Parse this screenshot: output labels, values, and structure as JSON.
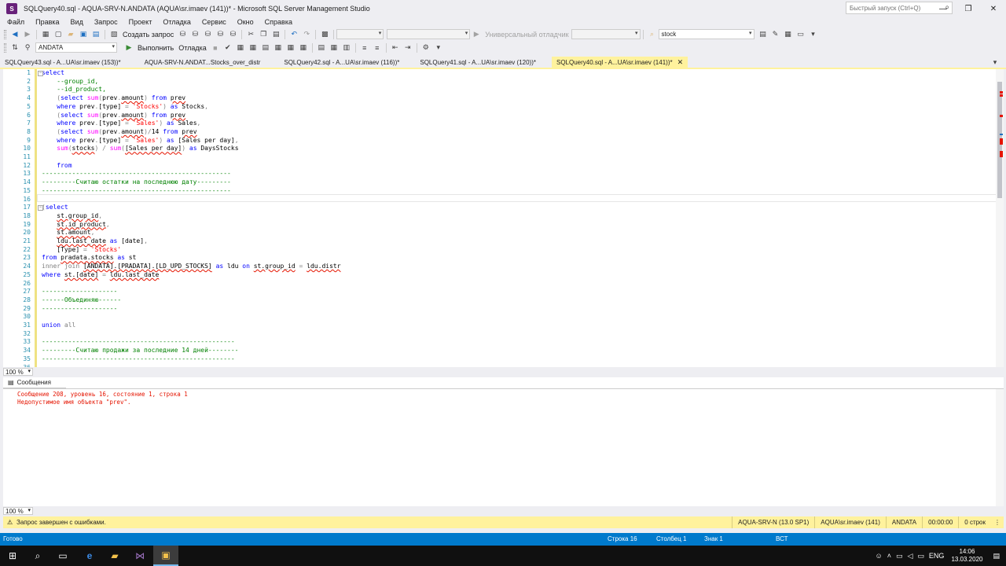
{
  "window": {
    "title": "SQLQuery40.sql - AQUA-SRV-N.ANDATA (AQUA\\sr.imaev (141))* - Microsoft SQL Server Management Studio",
    "quick_launch_placeholder": "Быстрый запуск (Ctrl+Q)"
  },
  "menu": [
    "Файл",
    "Правка",
    "Вид",
    "Запрос",
    "Проект",
    "Отладка",
    "Сервис",
    "Окно",
    "Справка"
  ],
  "toolbar1": {
    "new_query_label": "Создать запрос",
    "debugger_label": "Универсальный отладчик",
    "search_value": "stock"
  },
  "toolbar2": {
    "database": "ANDATA",
    "execute_label": "Выполнить",
    "debug_label": "Отладка"
  },
  "tabs": [
    {
      "label": "SQLQuery43.sql - A...UA\\sr.imaev (153))*",
      "active": false
    },
    {
      "label": "AQUA-SRV-N.ANDAT...Stocks_over_distr",
      "active": false
    },
    {
      "label": "SQLQuery42.sql - A...UA\\sr.imaev (116))*",
      "active": false
    },
    {
      "label": "SQLQuery41.sql - A...UA\\sr.imaev (120))*",
      "active": false
    },
    {
      "label": "SQLQuery40.sql - A...UA\\sr.imaev (141))*",
      "active": true
    }
  ],
  "editor": {
    "lines": [
      {
        "n": "1",
        "t": [
          [
            "kw",
            "select"
          ]
        ]
      },
      {
        "n": "2",
        "t": [
          [
            "cm",
            "    --group_id,"
          ]
        ]
      },
      {
        "n": "3",
        "t": [
          [
            "cm",
            "    --id_product,"
          ]
        ]
      },
      {
        "n": "4",
        "t": [
          [
            "gr",
            "    ("
          ],
          [
            "kw",
            "select "
          ],
          [
            "fn",
            "sum"
          ],
          [
            "gr",
            "("
          ],
          [
            "x",
            "prev"
          ],
          [
            "gr",
            "."
          ],
          [
            "sq",
            "amount"
          ],
          [
            "gr",
            ") "
          ],
          [
            "kw",
            "from "
          ],
          [
            "sq",
            "prev"
          ]
        ]
      },
      {
        "n": "5",
        "t": [
          [
            "kw",
            "    where "
          ],
          [
            "x",
            "prev"
          ],
          [
            "gr",
            "."
          ],
          [
            "x",
            "[type] "
          ],
          [
            "gr",
            "= "
          ],
          [
            "st",
            "'Stocks'"
          ],
          [
            "gr",
            ") "
          ],
          [
            "kw",
            "as "
          ],
          [
            "x",
            "Stocks"
          ],
          [
            "gr",
            ","
          ]
        ]
      },
      {
        "n": "6",
        "t": [
          [
            "gr",
            "    ("
          ],
          [
            "kw",
            "select "
          ],
          [
            "fn",
            "sum"
          ],
          [
            "gr",
            "("
          ],
          [
            "x",
            "prev"
          ],
          [
            "gr",
            "."
          ],
          [
            "sq",
            "amount"
          ],
          [
            "gr",
            ") "
          ],
          [
            "kw",
            "from "
          ],
          [
            "sq",
            "prev"
          ]
        ]
      },
      {
        "n": "7",
        "t": [
          [
            "kw",
            "    where "
          ],
          [
            "x",
            "prev"
          ],
          [
            "gr",
            "."
          ],
          [
            "x",
            "[type] "
          ],
          [
            "gr",
            "= "
          ],
          [
            "st",
            "'Sales'"
          ],
          [
            "gr",
            ") "
          ],
          [
            "kw",
            "as "
          ],
          [
            "x",
            "Sales"
          ],
          [
            "gr",
            ","
          ]
        ]
      },
      {
        "n": "8",
        "t": [
          [
            "gr",
            "    ("
          ],
          [
            "kw",
            "select "
          ],
          [
            "fn",
            "sum"
          ],
          [
            "gr",
            "("
          ],
          [
            "x",
            "prev"
          ],
          [
            "gr",
            "."
          ],
          [
            "sq",
            "amount"
          ],
          [
            "gr",
            ")/"
          ],
          [
            "x",
            "14 "
          ],
          [
            "kw",
            "from "
          ],
          [
            "sq",
            "prev"
          ]
        ]
      },
      {
        "n": "9",
        "t": [
          [
            "kw",
            "    where "
          ],
          [
            "x",
            "prev"
          ],
          [
            "gr",
            "."
          ],
          [
            "x",
            "[type] "
          ],
          [
            "gr",
            "= "
          ],
          [
            "st",
            "'Sales'"
          ],
          [
            "gr",
            ") "
          ],
          [
            "kw",
            "as "
          ],
          [
            "x",
            "[Sales per day]"
          ],
          [
            "gr",
            ","
          ]
        ]
      },
      {
        "n": "10",
        "t": [
          [
            "fn",
            "    sum"
          ],
          [
            "gr",
            "("
          ],
          [
            "sq",
            "stocks"
          ],
          [
            "gr",
            ") / "
          ],
          [
            "fn",
            "sum"
          ],
          [
            "gr",
            "("
          ],
          [
            "sq",
            "[Sales per day]"
          ],
          [
            "gr",
            ") "
          ],
          [
            "kw",
            "as "
          ],
          [
            "x",
            "DaysStocks"
          ]
        ]
      },
      {
        "n": "11",
        "t": []
      },
      {
        "n": "12",
        "t": [
          [
            "kw",
            "    from"
          ]
        ]
      },
      {
        "n": "13",
        "t": [
          [
            "cm",
            "--------------------------------------------------"
          ]
        ]
      },
      {
        "n": "14",
        "t": [
          [
            "cm",
            "---------Считаю остатки на последнюю дату---------"
          ]
        ]
      },
      {
        "n": "15",
        "t": [
          [
            "cm",
            "--------------------------------------------------"
          ]
        ]
      },
      {
        "n": "16",
        "t": []
      },
      {
        "n": "17",
        "t": [
          [
            "gr",
            "("
          ],
          [
            "kw",
            "select"
          ]
        ]
      },
      {
        "n": "18",
        "t": [
          [
            "x",
            "    "
          ],
          [
            "sq",
            "st.group_id"
          ],
          [
            "gr",
            ","
          ]
        ]
      },
      {
        "n": "19",
        "t": [
          [
            "x",
            "    "
          ],
          [
            "sq",
            "st.id_product"
          ],
          [
            "gr",
            ","
          ]
        ]
      },
      {
        "n": "20",
        "t": [
          [
            "x",
            "    "
          ],
          [
            "sq",
            "st.amount"
          ],
          [
            "gr",
            ","
          ]
        ]
      },
      {
        "n": "21",
        "t": [
          [
            "x",
            "    "
          ],
          [
            "sq",
            "ldu.last_date"
          ],
          [
            "kw",
            " as "
          ],
          [
            "x",
            "[date]"
          ],
          [
            "gr",
            ","
          ]
        ]
      },
      {
        "n": "22",
        "t": [
          [
            "x",
            "    [Type] "
          ],
          [
            "gr",
            "= "
          ],
          [
            "st",
            "'Stocks'"
          ]
        ]
      },
      {
        "n": "23",
        "t": [
          [
            "kw",
            "from "
          ],
          [
            "sq",
            "pradata.stocks"
          ],
          [
            "kw",
            " as "
          ],
          [
            "x",
            "st"
          ]
        ]
      },
      {
        "n": "24",
        "t": [
          [
            "gr",
            "inner join "
          ],
          [
            "sq",
            "[ANDATA].[PRADATA].[LD_UPD_STOCKS]"
          ],
          [
            "kw",
            " as "
          ],
          [
            "x",
            "ldu "
          ],
          [
            "kw",
            "on "
          ],
          [
            "sq",
            "st.group_id"
          ],
          [
            "gr",
            " = "
          ],
          [
            "sq",
            "ldu.distr"
          ]
        ]
      },
      {
        "n": "25",
        "t": [
          [
            "kw",
            "where "
          ],
          [
            "sq",
            "st.[date]"
          ],
          [
            "gr",
            " = "
          ],
          [
            "sq",
            "ldu.last_date"
          ]
        ]
      },
      {
        "n": "26",
        "t": []
      },
      {
        "n": "27",
        "t": [
          [
            "cm",
            "--------------------"
          ]
        ]
      },
      {
        "n": "28",
        "t": [
          [
            "cm",
            "------Объединяю------"
          ]
        ]
      },
      {
        "n": "29",
        "t": [
          [
            "cm",
            "--------------------"
          ]
        ]
      },
      {
        "n": "30",
        "t": []
      },
      {
        "n": "31",
        "t": [
          [
            "kw",
            "union "
          ],
          [
            "gr",
            "all"
          ]
        ]
      },
      {
        "n": "32",
        "t": []
      },
      {
        "n": "33",
        "t": [
          [
            "cm",
            "---------------------------------------------------"
          ]
        ]
      },
      {
        "n": "34",
        "t": [
          [
            "cm",
            "---------Считаю продажи за последние 14 дней--------"
          ]
        ]
      },
      {
        "n": "35",
        "t": [
          [
            "cm",
            "---------------------------------------------------"
          ]
        ]
      },
      {
        "n": "36",
        "t": []
      }
    ],
    "zoom": "100 %"
  },
  "results": {
    "tab_label": "Сообщения",
    "messages": [
      "Сообщение 208, уровень 16, состояние 1, строка 1",
      "Недопустимое имя объекта \"prev\"."
    ],
    "zoom": "100 %"
  },
  "query_status": {
    "message": "Запрос завершен с ошибками.",
    "server": "AQUA-SRV-N (13.0 SP1)",
    "user": "AQUA\\sr.imaev (141)",
    "database": "ANDATA",
    "time": "00:00:00",
    "rows": "0 строк"
  },
  "statusbar": {
    "ready": "Готово",
    "line": "Строка 16",
    "column": "Столбец 1",
    "char": "Знак 1",
    "mode": "ВСТ"
  },
  "taskbar": {
    "lang": "ENG",
    "time": "14:06",
    "date": "13.03.2020"
  },
  "colors": {
    "accent": "#007acc",
    "active_tab": "#fff29d",
    "error": "#e51400"
  }
}
